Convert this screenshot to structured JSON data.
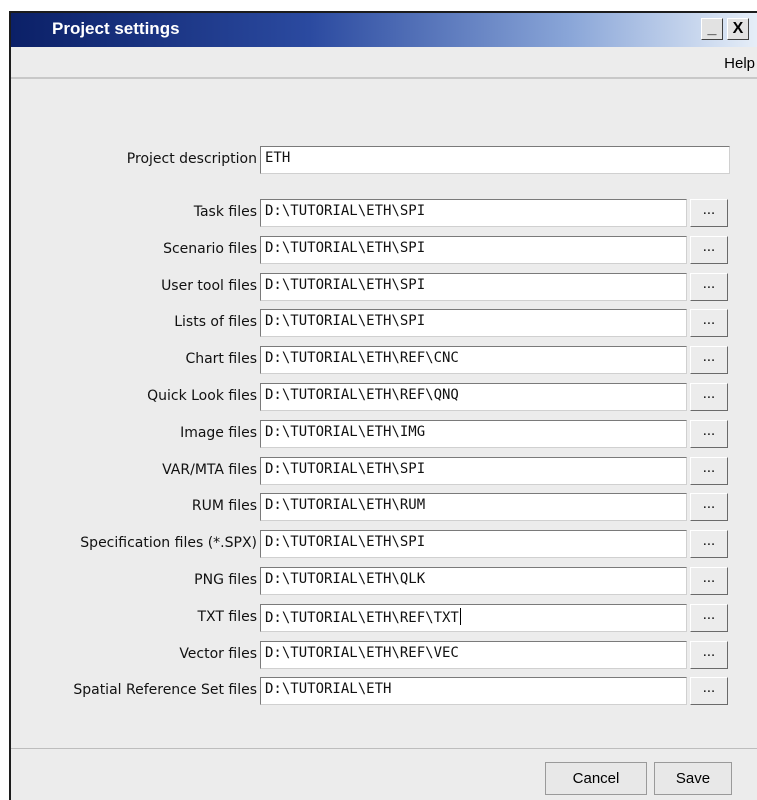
{
  "window": {
    "title": "Project settings",
    "minimize_label": "_",
    "close_label": "X"
  },
  "menu": {
    "help": "Help"
  },
  "project_description": {
    "label": "Project description",
    "value": "ETH"
  },
  "browse_label": "...",
  "fields": [
    {
      "label": "Task files",
      "value": "D:\\TUTORIAL\\ETH\\SPI"
    },
    {
      "label": "Scenario files",
      "value": "D:\\TUTORIAL\\ETH\\SPI"
    },
    {
      "label": "User tool files",
      "value": "D:\\TUTORIAL\\ETH\\SPI"
    },
    {
      "label": "Lists of files",
      "value": "D:\\TUTORIAL\\ETH\\SPI"
    },
    {
      "label": "Chart files",
      "value": "D:\\TUTORIAL\\ETH\\REF\\CNC"
    },
    {
      "label": "Quick Look files",
      "value": "D:\\TUTORIAL\\ETH\\REF\\QNQ"
    },
    {
      "label": "Image files",
      "value": "D:\\TUTORIAL\\ETH\\IMG"
    },
    {
      "label": "VAR/MTA files",
      "value": "D:\\TUTORIAL\\ETH\\SPI"
    },
    {
      "label": "RUM files",
      "value": "D:\\TUTORIAL\\ETH\\RUM"
    },
    {
      "label": "Specification files (*.SPX)",
      "value": "D:\\TUTORIAL\\ETH\\SPI"
    },
    {
      "label": "PNG files",
      "value": "D:\\TUTORIAL\\ETH\\QLK"
    },
    {
      "label": "TXT files",
      "value": "D:\\TUTORIAL\\ETH\\REF\\TXT"
    },
    {
      "label": "Vector files",
      "value": "D:\\TUTORIAL\\ETH\\REF\\VEC"
    },
    {
      "label": "Spatial Reference Set files",
      "value": "D:\\TUTORIAL\\ETH"
    }
  ],
  "buttons": {
    "cancel": "Cancel",
    "save": "Save"
  }
}
